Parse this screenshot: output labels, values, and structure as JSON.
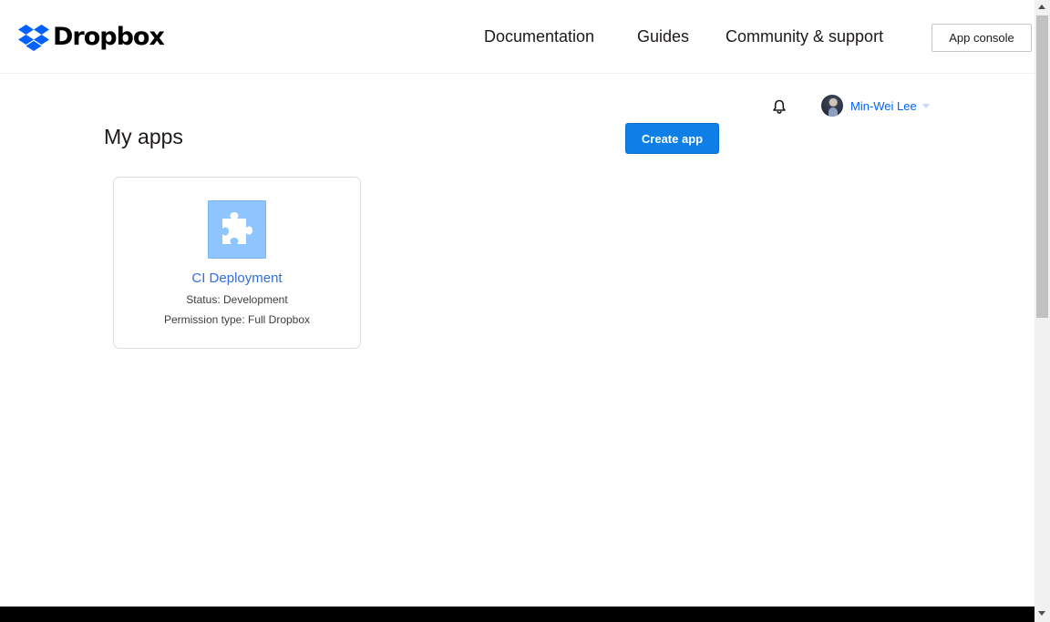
{
  "header": {
    "logo_text": "Dropbox",
    "nav": [
      {
        "label": "Documentation"
      },
      {
        "label": "Guides"
      },
      {
        "label": "Community & support"
      }
    ],
    "app_console_label": "App console"
  },
  "user": {
    "name": "Min-Wei Lee",
    "notifications_icon": "bell-icon"
  },
  "main": {
    "title": "My apps",
    "create_button_label": "Create app",
    "apps": [
      {
        "name": "CI Deployment",
        "status": "Status: Development",
        "permission": "Permission type: Full Dropbox",
        "icon": "puzzle-piece-icon"
      }
    ]
  },
  "colors": {
    "brand_blue": "#0061fe",
    "button_blue": "#0d7fe7",
    "app_icon_bg": "#8ec5ff",
    "link_blue": "#2f6fde"
  }
}
